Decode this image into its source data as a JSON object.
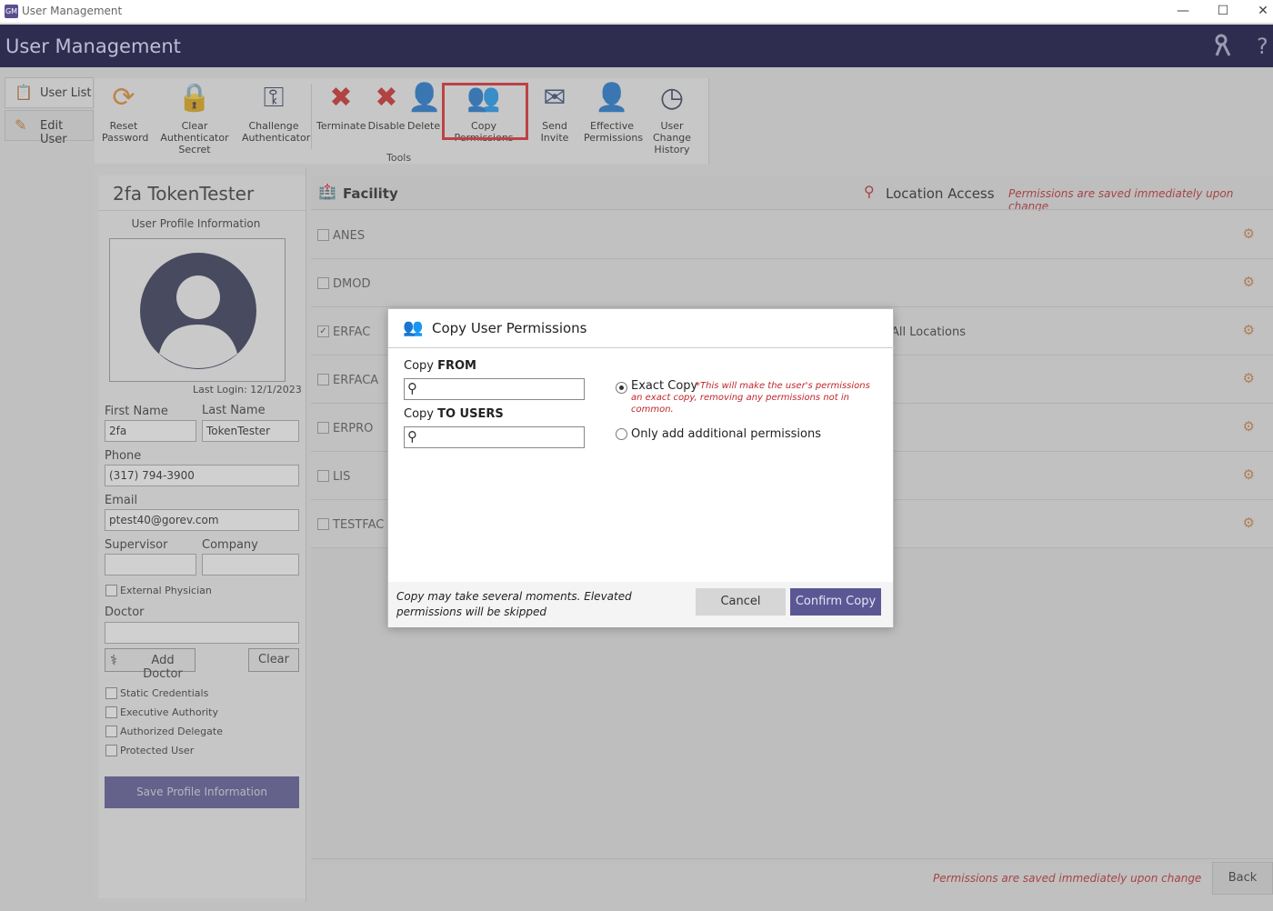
{
  "window": {
    "title": "User Management",
    "app_icon_text": "GM"
  },
  "header": {
    "title": "User Management"
  },
  "side_tabs": [
    {
      "label": "User List"
    },
    {
      "label": "Edit User"
    }
  ],
  "toolbar": {
    "caption": "Tools",
    "tools": [
      {
        "label": "Reset\nPassword"
      },
      {
        "label": "Clear Authenticator\nSecret"
      },
      {
        "label": "Challenge\nAuthenticator"
      },
      {
        "label": "Terminate"
      },
      {
        "label": "Disable"
      },
      {
        "label": "Delete"
      },
      {
        "label": "Copy Permissions"
      },
      {
        "label": "Send Invite"
      },
      {
        "label": "Effective\nPermissions"
      },
      {
        "label": "User Change\nHistory"
      }
    ]
  },
  "profile": {
    "name": "2fa TokenTester",
    "section_title": "User Profile Information",
    "last_login": "Last Login: 12/1/2023",
    "first_name_label": "First Name",
    "first_name": "2fa",
    "last_name_label": "Last Name",
    "last_name": "TokenTester",
    "phone_label": "Phone",
    "phone": "(317) 794-3900",
    "email_label": "Email",
    "email": "ptest40@gorev.com",
    "supervisor_label": "Supervisor",
    "company_label": "Company",
    "external_physician_label": "External Physician",
    "doctor_label": "Doctor",
    "add_doctor_label": "Add Doctor",
    "clear_label": "Clear",
    "flags": [
      {
        "label": "Static Credentials"
      },
      {
        "label": "Executive Authority"
      },
      {
        "label": "Authorized Delegate"
      },
      {
        "label": "Protected User"
      }
    ],
    "save_label": "Save Profile Information"
  },
  "facility_panel": {
    "facility_header": "Facility",
    "location_header": "Location Access",
    "notice": "Permissions are saved immediately upon change",
    "erfac_location": "All Locations",
    "facilities": [
      {
        "name": "ANES",
        "checked": ""
      },
      {
        "name": "DMOD",
        "checked": ""
      },
      {
        "name": "ERFAC",
        "checked": "✓"
      },
      {
        "name": "ERFACA",
        "checked": ""
      },
      {
        "name": "ERPRO",
        "checked": ""
      },
      {
        "name": "LIS",
        "checked": ""
      },
      {
        "name": "TESTFAC",
        "checked": ""
      }
    ],
    "bottom_notice": "Permissions are saved immediately upon change",
    "back_label": "Back"
  },
  "modal": {
    "title": "Copy User Permissions",
    "copy_from_prefix": "Copy ",
    "copy_from_bold": "FROM",
    "copy_to_prefix": "Copy ",
    "copy_to_bold": "TO USERS",
    "exact_copy_label": "Exact Copy",
    "exact_copy_note": "*This will make the user's permissions an exact copy, removing any permissions not in common.",
    "additional_label": "Only add additional permissions",
    "footer_note": "Copy may take several moments. Elevated permissions will be skipped",
    "cancel_label": "Cancel",
    "confirm_label": "Confirm Copy"
  },
  "colors": {
    "header_bg": "#2f2d4f",
    "accent": "#5a5794",
    "highlight": "#e0262b",
    "notice_red": "#c0272d"
  }
}
